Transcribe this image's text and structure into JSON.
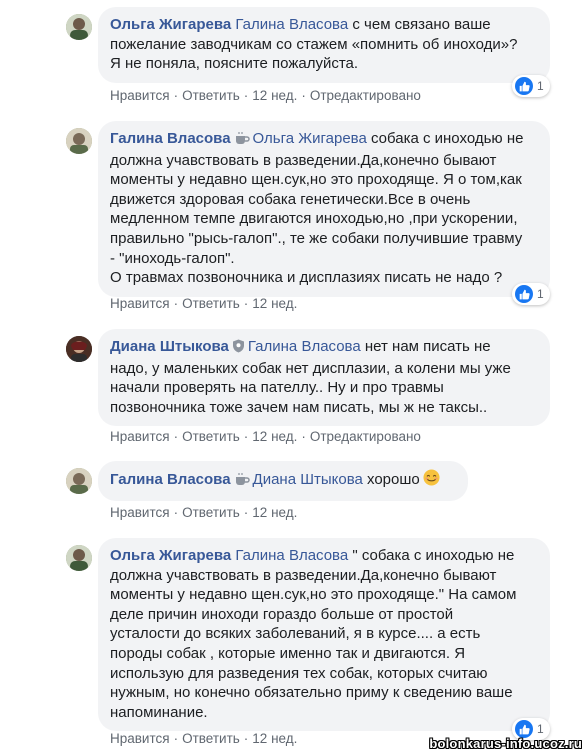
{
  "comments": [
    {
      "author": "Ольга Жигарева",
      "mention": "Галина Власова",
      "lines": [
        " с чем связано ваше",
        "пожелание заводчикам со стажем «помнить об иноходи»?",
        "Я не поняла, поясните пожалуйста."
      ],
      "actions": {
        "like": "Нравится",
        "reply": "Ответить",
        "time": "12 нед.",
        "edited": "Отредактировано"
      },
      "reactions": "1"
    },
    {
      "author": "Галина Власова",
      "author_icon": "coffee-cup-icon",
      "mention": "Ольга Жигарева",
      "lines": [
        " собака с иноходью не",
        "должна учавствовать в разведении.Да,конечно бывают",
        "моменты у недавно щен.сук,но это проходяще. Я о том,как",
        "движется здоровая собака генетически.Все в очень",
        "медленном темпе двигаются иноходью,но ,при ускорении,",
        "правильно \"рысь-галоп\"., те же собаки получившие травму",
        "- \"иноходь-галоп\".",
        "О травмах позвоночника и дисплазиях писать не надо ?"
      ],
      "actions": {
        "like": "Нравится",
        "reply": "Ответить",
        "time": "12 нед."
      },
      "reactions": "1"
    },
    {
      "author": "Диана Штыкова",
      "author_icon": "shield-badge-icon",
      "mention": "Галина Власова",
      "lines": [
        " нет нам писать не",
        "надо, у маленьких собак нет дисплазии, а колени мы уже",
        "начали проверять на пателлу.. Ну и про травмы",
        "позвоночника тоже зачем нам писать, мы ж не таксы.."
      ],
      "actions": {
        "like": "Нравится",
        "reply": "Ответить",
        "time": "12 нед.",
        "edited": "Отредактировано"
      }
    },
    {
      "author": "Галина Власова",
      "author_icon": "coffee-cup-icon",
      "mention": "Диана Штыкова",
      "lines": [
        " хорошо"
      ],
      "emoji": "smiling-face-emoji",
      "actions": {
        "like": "Нравится",
        "reply": "Ответить",
        "time": "12 нед."
      }
    },
    {
      "author": "Ольга Жигарева",
      "mention": "Галина Власова",
      "lines": [
        " \" собака с иноходью не",
        "должна учавствовать в разведении.Да,конечно бывают",
        "моменты у недавно щен.сук,но это проходяще.\" На самом",
        "деле причин иноходи гораздо больше от простой",
        "усталости до всяких заболеваний, я в курсе.... а есть",
        "породы собак , которые именно так и двигаются. Я",
        "использую для разведения тех собак, которых считаю",
        "нужным, но конечно обязательно приму к сведению ваше",
        "напоминание."
      ],
      "actions": {
        "like": "Нравится",
        "reply": "Ответить",
        "time": "12 нед."
      },
      "reactions": "1"
    }
  ],
  "watermark": "bolonkarus-info.ucoz.ru",
  "colors": {
    "link": "#385898",
    "bubble": "#f2f3f5",
    "meta": "#606770",
    "like": "#1877f2"
  }
}
